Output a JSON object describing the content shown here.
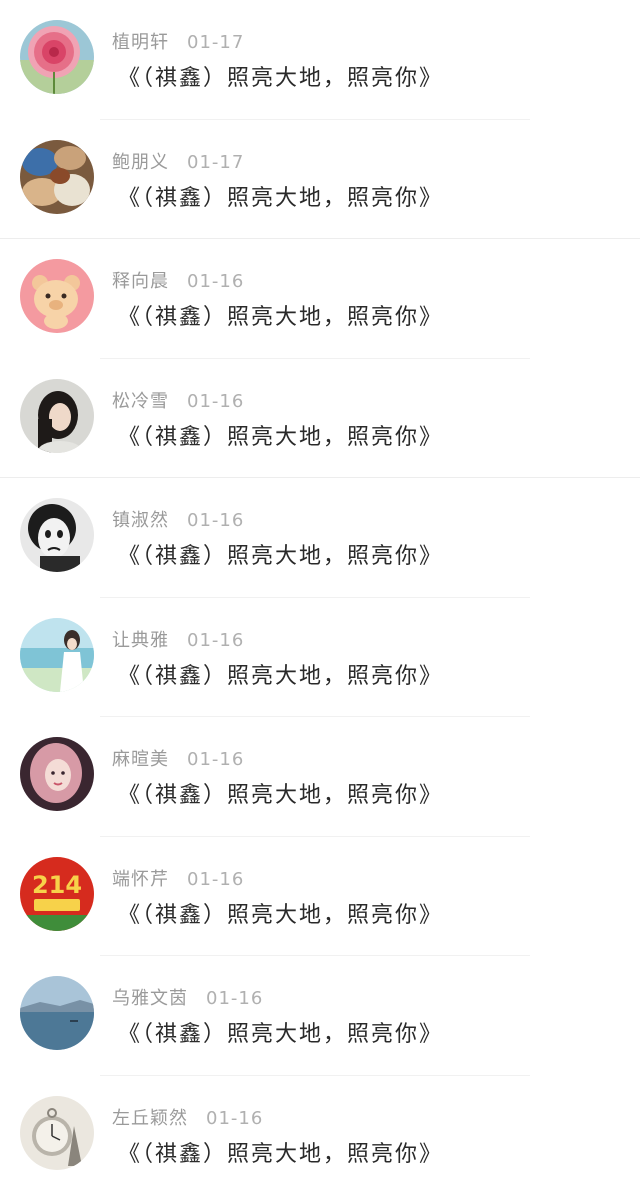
{
  "messages": [
    {
      "name": "植明轩",
      "date": "01-17",
      "text": "《（祺鑫）照亮大地，照亮你》",
      "avatar": "flower-avatar",
      "accent": "#e86a7a"
    },
    {
      "name": "鲍朋义",
      "date": "01-17",
      "text": "《（祺鑫）照亮大地，照亮你》",
      "avatar": "shells-avatar",
      "accent": "#3e6fa8"
    },
    {
      "name": "释向晨",
      "date": "01-16",
      "text": "《（祺鑫）照亮大地，照亮你》",
      "avatar": "cartoon-bear-avatar",
      "accent": "#f2a0a4"
    },
    {
      "name": "松冷雪",
      "date": "01-16",
      "text": "《（祺鑫）照亮大地，照亮你》",
      "avatar": "girl-portrait-avatar",
      "accent": "#cfcfcf"
    },
    {
      "name": "镇淑然",
      "date": "01-16",
      "text": "《（祺鑫）照亮大地，照亮你》",
      "avatar": "mime-face-avatar",
      "accent": "#2a2a2a"
    },
    {
      "name": "让典雅",
      "date": "01-16",
      "text": "《（祺鑫）照亮大地，照亮你》",
      "avatar": "lakeside-girl-avatar",
      "accent": "#9fd3e0"
    },
    {
      "name": "麻暄美",
      "date": "01-16",
      "text": "《（祺鑫）照亮大地，照亮你》",
      "avatar": "pink-hair-girl-avatar",
      "accent": "#d9a0a8"
    },
    {
      "name": "端怀芹",
      "date": "01-16",
      "text": "《（祺鑫）照亮大地，照亮你》",
      "avatar": "valentines-214-avatar",
      "avatar_text": "214",
      "accent": "#d62b1e"
    },
    {
      "name": "乌雅文茵",
      "date": "01-16",
      "text": "《（祺鑫）照亮大地，照亮你》",
      "avatar": "lake-landscape-avatar",
      "accent": "#5f8fb0"
    },
    {
      "name": "左丘颖然",
      "date": "01-16",
      "text": "《（祺鑫）照亮大地，照亮你》",
      "avatar": "pocket-watch-avatar",
      "accent": "#d8d4cc"
    }
  ]
}
